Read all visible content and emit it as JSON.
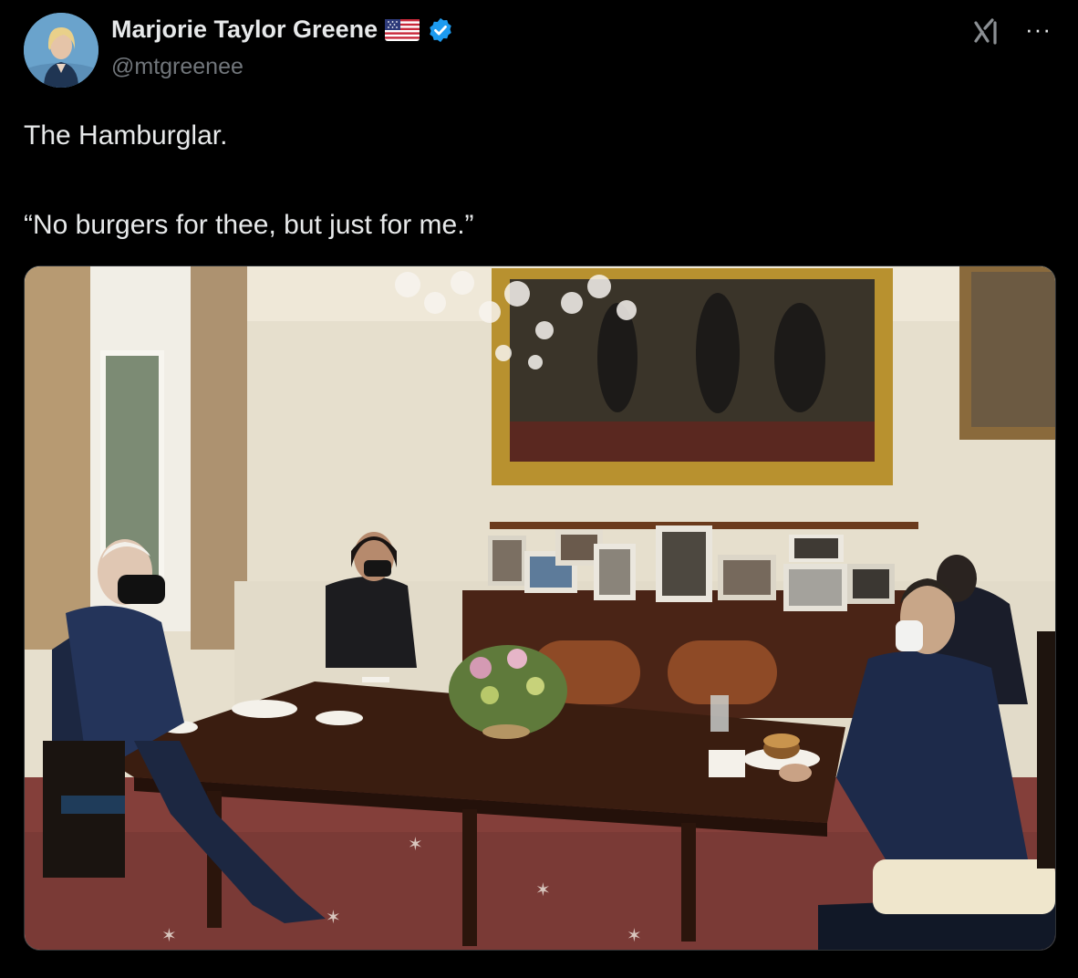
{
  "author": {
    "display_name": "Marjorie Taylor Greene",
    "handle": "@mtgreenee",
    "avatar_icon": "profile-photo-avatar",
    "badges": [
      "us-flag-icon",
      "verified-badge-icon"
    ],
    "verified_color": "#1d9bf0"
  },
  "header_actions": {
    "grok_icon": "grok-icon",
    "more_icon": "more-options-icon",
    "more_label": "···"
  },
  "tweet": {
    "line1": "The Hamburglar.",
    "line2": "“No burgers for thee, but just for me.”"
  },
  "media": {
    "type": "photo",
    "subject": "dining-room-lunch-photo"
  },
  "colors": {
    "background": "#000000",
    "text_primary": "#e7e9ea",
    "text_secondary": "#71767b"
  }
}
